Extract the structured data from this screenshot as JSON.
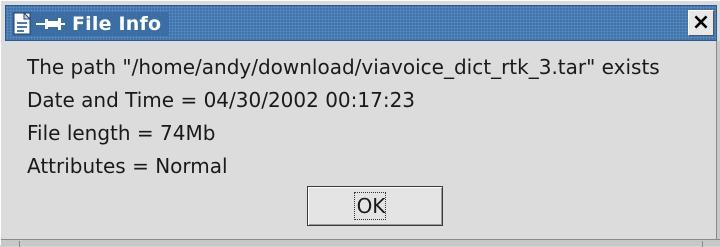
{
  "window": {
    "title": "File Info",
    "app_icon": "file-icon",
    "pin_icon": "pin-icon",
    "close_glyph": "×",
    "close_icon": "close-icon"
  },
  "info": {
    "path_line": "The path \"/home/andy/download/viavoice_dict_rtk_3.tar\" exists",
    "date_line": "Date and Time = 04/30/2002 00:17:23",
    "length_line": "File length = 74Mb",
    "attributes_line": "Attributes = Normal"
  },
  "buttons": {
    "ok_label": "OK"
  },
  "colors": {
    "titlebar": "#3a6ea5",
    "background": "#dcdcdc"
  }
}
